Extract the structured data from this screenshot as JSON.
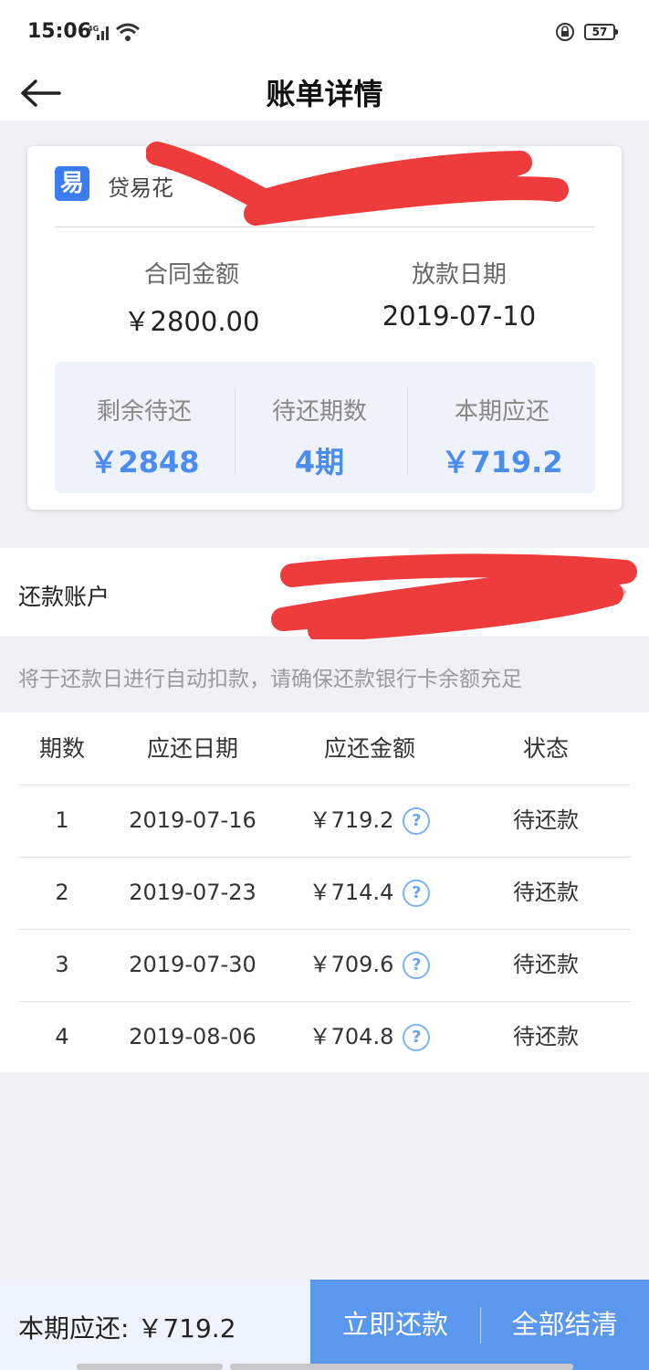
{
  "status_bar": {
    "time": "15:06",
    "network": "4G",
    "battery": "57"
  },
  "nav": {
    "title": "账单详情"
  },
  "card": {
    "brand_icon_char": "易",
    "brand_name": "贷易花",
    "contract_amount_label": "合同金额",
    "contract_amount": "￥2800.00",
    "loan_date_label": "放款日期",
    "loan_date": "2019-07-10",
    "remaining_label": "剩余待还",
    "remaining": "￥2848",
    "periods_label": "待还期数",
    "periods": "4期",
    "current_due_label": "本期应还",
    "current_due": "￥719.2"
  },
  "account": {
    "label": "还款账户"
  },
  "notice": "将于还款日进行自动扣款，请确保还款银行卡余额充足",
  "table": {
    "headers": [
      "期数",
      "应还日期",
      "应还金额",
      "状态"
    ],
    "rows": [
      {
        "period": "1",
        "date": "2019-07-16",
        "amount": "￥719.2",
        "status": "待还款"
      },
      {
        "period": "2",
        "date": "2019-07-23",
        "amount": "￥714.4",
        "status": "待还款"
      },
      {
        "period": "3",
        "date": "2019-07-30",
        "amount": "￥709.6",
        "status": "待还款"
      },
      {
        "period": "4",
        "date": "2019-08-06",
        "amount": "￥704.8",
        "status": "待还款"
      }
    ]
  },
  "bottom": {
    "due_label": "本期应还:",
    "due_value": "￥719.2",
    "pay_now": "立即还款",
    "pay_all": "全部结清"
  },
  "colors": {
    "accent": "#4a8cf0",
    "button": "#5a98f0",
    "redaction": "#ee3b3b"
  }
}
